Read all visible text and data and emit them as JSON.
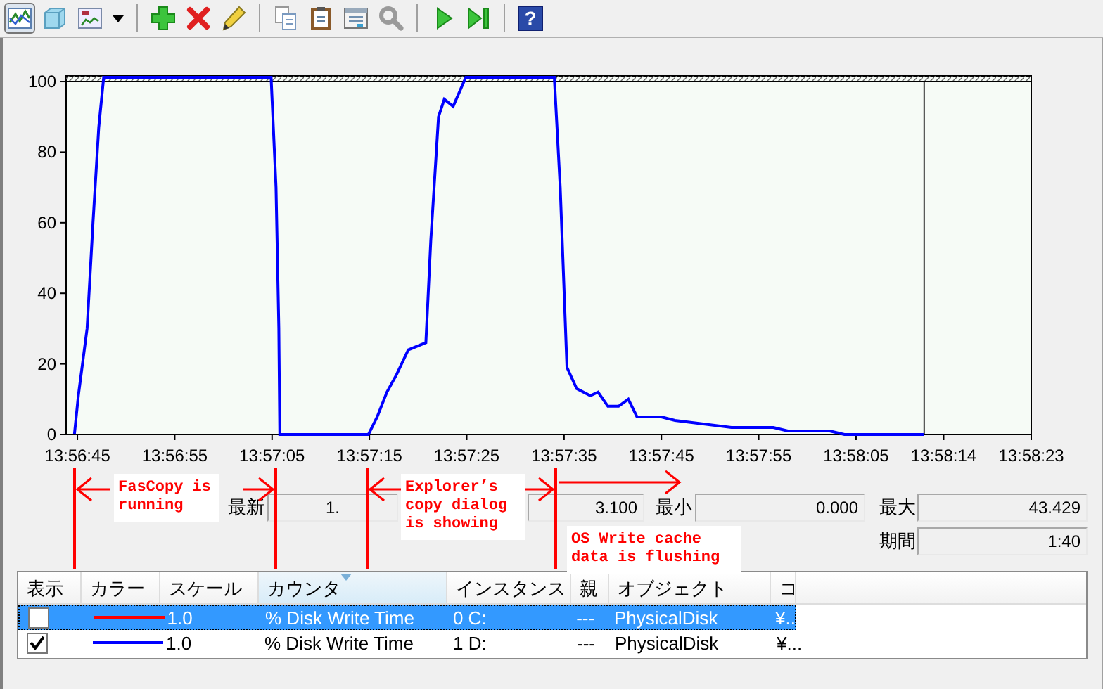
{
  "toolbar": [
    {
      "kind": "line-graph",
      "selected": true
    },
    {
      "kind": "histogram",
      "selected": false
    },
    {
      "kind": "report",
      "selected": false
    },
    {
      "kind": "dropdown",
      "disabled": false
    },
    {
      "kind": "separator"
    },
    {
      "kind": "add",
      "disabled": false
    },
    {
      "kind": "delete",
      "disabled": false
    },
    {
      "kind": "edit",
      "disabled": false
    },
    {
      "kind": "separator"
    },
    {
      "kind": "copy",
      "disabled": false
    },
    {
      "kind": "paste",
      "disabled": false
    },
    {
      "kind": "properties",
      "disabled": false
    },
    {
      "kind": "zoom",
      "disabled": true
    },
    {
      "kind": "separator"
    },
    {
      "kind": "play",
      "disabled": false
    },
    {
      "kind": "step",
      "disabled": false
    },
    {
      "kind": "separator"
    },
    {
      "kind": "help",
      "glyph": "?",
      "disabled": false
    }
  ],
  "graph": {
    "chart_data": {
      "type": "line",
      "ref_lines": [
        {
          "axis": "x",
          "value": 50292
        }
      ],
      "bands": [
        {
          "axis": "y",
          "from": 100,
          "to": 101.6
        }
      ],
      "xlim": [
        50203.84,
        50303
      ],
      "ylim": [
        0,
        101.6
      ],
      "yticks": [
        0,
        20,
        40,
        60,
        80,
        100
      ],
      "xticks": [
        {
          "value": 50205,
          "label": "13:56:45"
        },
        {
          "value": 50215,
          "label": "13:56:55"
        },
        {
          "value": 50225,
          "label": "13:57:05"
        },
        {
          "value": 50235,
          "label": "13:57:15"
        },
        {
          "value": 50245,
          "label": "13:57:25"
        },
        {
          "value": 50255,
          "label": "13:57:35"
        },
        {
          "value": 50265,
          "label": "13:57:45"
        },
        {
          "value": 50275,
          "label": "13:57:55"
        },
        {
          "value": 50285,
          "label": "13:58:05"
        },
        {
          "value": 50294,
          "label": "13:58:14"
        },
        {
          "value": 50303,
          "label": "13:58:23"
        }
      ],
      "x": [
        50204.7,
        50205.1,
        50206.0,
        50206.6,
        50207.2,
        50207.7,
        50224.9,
        50225.4,
        50225.7,
        50225.8,
        50234.9,
        50235.8,
        50236.8,
        50237.8,
        50239.0,
        50240.8,
        50241.3,
        50242.1,
        50242.7,
        50243.6,
        50244.9,
        50254.0,
        50254.6,
        50255.3,
        50256.3,
        50257.7,
        50258.5,
        50259.5,
        50260.6,
        50261.6,
        50262.5,
        50265.0,
        50266.4,
        50269.3,
        50272.2,
        50276.5,
        50278.0,
        50282.3,
        50283.8,
        50292.0
      ],
      "series": [
        {
          "color": "#0000ff",
          "values": [
            0,
            11,
            30,
            60,
            87,
            101.2,
            101.2,
            70,
            30,
            0,
            0,
            5,
            12,
            17,
            24,
            26,
            55,
            90,
            95,
            93,
            101.2,
            101.2,
            70,
            19,
            13,
            11,
            12,
            8,
            8,
            10,
            5,
            5,
            4,
            3,
            2,
            2,
            1,
            1,
            0,
            0
          ]
        }
      ]
    }
  },
  "stats": {
    "latest": {
      "label": "最新",
      "value": "1."
    },
    "average": {
      "value": "3.100"
    },
    "minimum": {
      "label": "最小",
      "value": "0.000"
    },
    "maximum": {
      "label": "最大",
      "value": "43.429"
    },
    "duration": {
      "label": "期間",
      "value": "1:40"
    }
  },
  "counters": {
    "columns": [
      {
        "label": "表示",
        "sorted": false
      },
      {
        "label": "カラー",
        "sorted": false
      },
      {
        "label": "スケール",
        "sorted": false
      },
      {
        "label": "カウンタ",
        "sorted": true
      },
      {
        "label": "インスタンス",
        "sorted": false
      },
      {
        "label": "親",
        "sorted": false
      },
      {
        "label": "オブジェクト",
        "sorted": false
      },
      {
        "label": "コ",
        "sorted": false
      }
    ],
    "rows": [
      {
        "selected": true,
        "cells": [
          {
            "kind": "checkbox",
            "checked": false
          },
          {
            "kind": "swatch",
            "color": "#ff0000"
          },
          {
            "kind": "text",
            "text": "1.0"
          },
          {
            "kind": "text",
            "text": "% Disk Write Time"
          },
          {
            "kind": "text",
            "text": "0 C:"
          },
          {
            "kind": "text",
            "text": "---"
          },
          {
            "kind": "text",
            "text": "PhysicalDisk"
          },
          {
            "kind": "text",
            "text": "¥.."
          }
        ]
      },
      {
        "selected": false,
        "cells": [
          {
            "kind": "checkbox",
            "checked": true
          },
          {
            "kind": "swatch",
            "color": "#0000ff"
          },
          {
            "kind": "text",
            "text": "1.0"
          },
          {
            "kind": "text",
            "text": "% Disk Write Time"
          },
          {
            "kind": "text",
            "text": "1 D:"
          },
          {
            "kind": "text",
            "text": "---"
          },
          {
            "kind": "text",
            "text": "PhysicalDisk"
          },
          {
            "kind": "text",
            "text": "¥..."
          }
        ]
      }
    ]
  },
  "annotations": [
    {
      "text": "FasCopy is running"
    },
    {
      "text": "Explorer’s copy dialog is showing"
    },
    {
      "text": "OS Write cache data is flushing"
    }
  ]
}
